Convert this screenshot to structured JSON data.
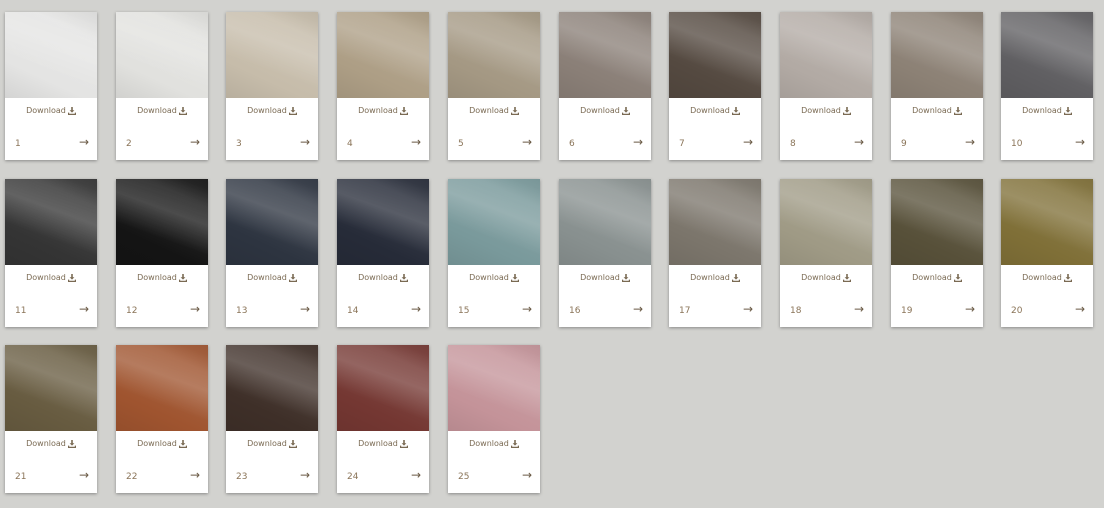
{
  "download_label": "Download",
  "colors": [
    {
      "id": "1",
      "swatch": "#e4e4e3"
    },
    {
      "id": "2",
      "swatch": "#e1e1de"
    },
    {
      "id": "3",
      "swatch": "#c6bcaa"
    },
    {
      "id": "4",
      "swatch": "#ad9e85"
    },
    {
      "id": "5",
      "swatch": "#a49883"
    },
    {
      "id": "6",
      "swatch": "#8a7f77"
    },
    {
      "id": "7",
      "swatch": "#544940"
    },
    {
      "id": "8",
      "swatch": "#b2aaa4"
    },
    {
      "id": "9",
      "swatch": "#8c8175"
    },
    {
      "id": "10",
      "swatch": "#5f5e61"
    },
    {
      "id": "11",
      "swatch": "#343434"
    },
    {
      "id": "12",
      "swatch": "#141414"
    },
    {
      "id": "13",
      "swatch": "#2d3440"
    },
    {
      "id": "14",
      "swatch": "#262b38"
    },
    {
      "id": "15",
      "swatch": "#79999b"
    },
    {
      "id": "16",
      "swatch": "#88908f"
    },
    {
      "id": "17",
      "swatch": "#7b756b"
    },
    {
      "id": "18",
      "swatch": "#9f9a85"
    },
    {
      "id": "19",
      "swatch": "#575039"
    },
    {
      "id": "20",
      "swatch": "#7f6f37"
    },
    {
      "id": "21",
      "swatch": "#675b40"
    },
    {
      "id": "22",
      "swatch": "#9f542f"
    },
    {
      "id": "23",
      "swatch": "#3e2f28"
    },
    {
      "id": "24",
      "swatch": "#743732"
    },
    {
      "id": "25",
      "swatch": "#c49399"
    }
  ]
}
